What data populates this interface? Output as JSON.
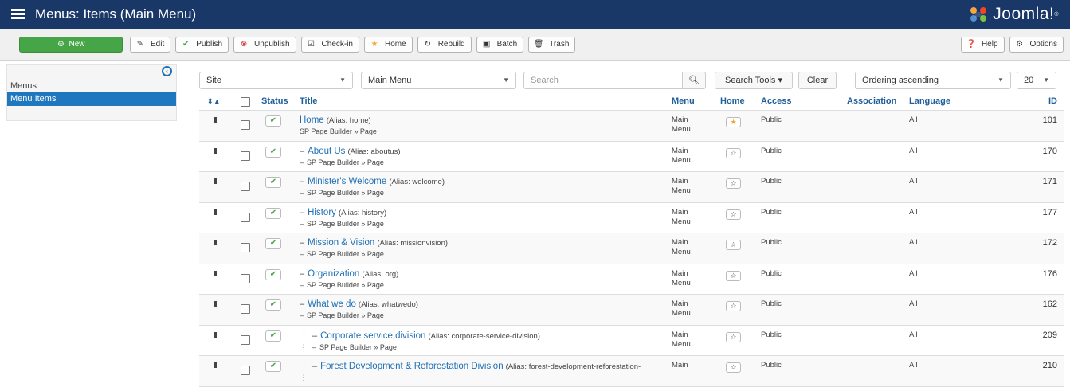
{
  "header": {
    "title": "Menus: Items (Main Menu)",
    "logo_text": "Joomla!",
    "bg_color": "#1a3867"
  },
  "toolbar": {
    "new_label": "New",
    "edit_label": "Edit",
    "publish_label": "Publish",
    "unpublish_label": "Unpublish",
    "checkin_label": "Check-in",
    "home_label": "Home",
    "rebuild_label": "Rebuild",
    "batch_label": "Batch",
    "trash_label": "Trash",
    "help_label": "Help",
    "options_label": "Options"
  },
  "sidebar": {
    "items": [
      {
        "label": "Menus"
      },
      {
        "label": "Menu Items"
      }
    ]
  },
  "filters": {
    "client_value": "Site",
    "menu_value": "Main Menu",
    "search_placeholder": "Search",
    "search_tools_label": "Search Tools",
    "clear_label": "Clear",
    "ordering_value": "Ordering ascending",
    "limit_value": "20"
  },
  "table": {
    "headers": {
      "status": "Status",
      "title": "Title",
      "menu": "Menu",
      "home": "Home",
      "access": "Access",
      "association": "Association",
      "language": "Language",
      "id": "ID"
    },
    "rows": [
      {
        "title": "Home",
        "alias": "(Alias: home)",
        "type": "SP Page Builder » Page",
        "menu": [
          "Main",
          "Menu"
        ],
        "access": "Public",
        "language": "All",
        "id": "101"
      },
      {
        "title": "About Us",
        "alias": "(Alias: aboutus)",
        "type": "SP Page Builder » Page",
        "menu": [
          "Main",
          "Menu"
        ],
        "access": "Public",
        "language": "All",
        "id": "170"
      },
      {
        "title": "Minister's Welcome",
        "alias": "(Alias: welcome)",
        "type": "SP Page Builder » Page",
        "menu": [
          "Main",
          "Menu"
        ],
        "access": "Public",
        "language": "All",
        "id": "171"
      },
      {
        "title": "History",
        "alias": "(Alias: history)",
        "type": "SP Page Builder » Page",
        "menu": [
          "Main",
          "Menu"
        ],
        "access": "Public",
        "language": "All",
        "id": "177"
      },
      {
        "title": "Mission & Vision",
        "alias": "(Alias: missionvision)",
        "type": "SP Page Builder » Page",
        "menu": [
          "Main",
          "Menu"
        ],
        "access": "Public",
        "language": "All",
        "id": "172"
      },
      {
        "title": "Organization",
        "alias": "(Alias: org)",
        "type": "SP Page Builder » Page",
        "menu": [
          "Main",
          "Menu"
        ],
        "access": "Public",
        "language": "All",
        "id": "176"
      },
      {
        "title": "What we do",
        "alias": "(Alias: whatwedo)",
        "type": "SP Page Builder » Page",
        "menu": [
          "Main",
          "Menu"
        ],
        "access": "Public",
        "language": "All",
        "id": "162"
      },
      {
        "title": "Corporate service division",
        "alias": "(Alias: corporate-service-division)",
        "type": "SP Page Builder » Page",
        "menu": [
          "Main",
          "Menu"
        ],
        "access": "Public",
        "language": "All",
        "id": "209"
      },
      {
        "title": "Forest Development & Reforestation Division",
        "alias": "(Alias: forest-development-reforestation-",
        "type": "",
        "menu": [
          "Main",
          ""
        ],
        "access": "Public",
        "language": "All",
        "id": "210"
      }
    ]
  },
  "colors": {
    "accent": "#1f77bd",
    "new_button": "#46a546",
    "status_check": "#46a546",
    "home_star": "#f3a537"
  }
}
